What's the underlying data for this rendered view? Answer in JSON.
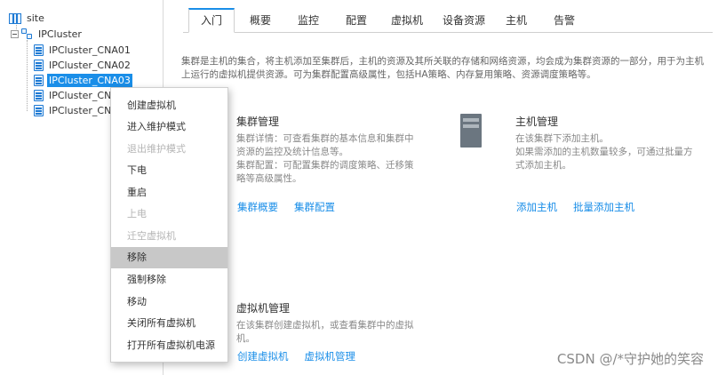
{
  "tree": {
    "root_label": "site",
    "cluster_label": "IPCluster",
    "hosts": [
      {
        "label": "IPCluster_CNA01",
        "selected": false
      },
      {
        "label": "IPCluster_CNA02",
        "selected": false
      },
      {
        "label": "IPCluster_CNA03",
        "selected": true
      },
      {
        "label": "IPCluster_CNA",
        "selected": false
      },
      {
        "label": "IPCluster_CNA",
        "selected": false
      }
    ]
  },
  "tabs": [
    {
      "label": "入门",
      "active": true
    },
    {
      "label": "概要",
      "active": false
    },
    {
      "label": "监控",
      "active": false
    },
    {
      "label": "配置",
      "active": false
    },
    {
      "label": "虚拟机",
      "active": false
    },
    {
      "label": "设备资源",
      "active": false
    },
    {
      "label": "主机",
      "active": false
    },
    {
      "label": "告警",
      "active": false
    }
  ],
  "intro": {
    "line1": "集群是主机的集合，将主机添加至集群后，主机的资源及其所关联的存储和网络资源，均会成为集群资源的一部分，用于为主机",
    "line2": "上运行的虚拟机提供资源。可为集群配置高级属性，包括HA策略、内存复用策略、资源调度策略等。"
  },
  "cluster_mgmt": {
    "title": "集群管理",
    "desc1": "集群详情：可查看集群的基本信息和集群中",
    "desc2": "资源的监控及统计信息等。",
    "desc3": "集群配置：可配置集群的调度策略、迁移策",
    "desc4": "略等高级属性。",
    "link1": "集群概要",
    "link2": "集群配置"
  },
  "host_mgmt": {
    "icon": "server-icon",
    "title": "主机管理",
    "desc1": "在该集群下添加主机。",
    "desc2": "如果需添加的主机数量较多，可通过批量方",
    "desc3": "式添加主机。",
    "link1": "添加主机",
    "link2": "批量添加主机"
  },
  "vm_mgmt": {
    "title": "虚拟机管理",
    "desc1": "在该集群创建虚拟机，或查看集群中的虚拟",
    "desc2": "机。",
    "link1": "创建虚拟机",
    "link2": "虚拟机管理"
  },
  "context_menu": {
    "items": [
      {
        "label": "创建虚拟机",
        "disabled": false,
        "hover": false
      },
      {
        "label": "进入维护模式",
        "disabled": false,
        "hover": false
      },
      {
        "label": "退出维护模式",
        "disabled": true,
        "hover": false
      },
      {
        "label": "下电",
        "disabled": false,
        "hover": false
      },
      {
        "label": "重启",
        "disabled": false,
        "hover": false
      },
      {
        "label": "上电",
        "disabled": true,
        "hover": false
      },
      {
        "label": "迁空虚拟机",
        "disabled": true,
        "hover": false
      },
      {
        "label": "移除",
        "disabled": false,
        "hover": true
      },
      {
        "label": "强制移除",
        "disabled": false,
        "hover": false
      },
      {
        "label": "移动",
        "disabled": false,
        "hover": false
      },
      {
        "label": "关闭所有虚拟机",
        "disabled": false,
        "hover": false
      },
      {
        "label": "打开所有虚拟机电源",
        "disabled": false,
        "hover": false
      }
    ]
  },
  "watermark": "CSDN @/*守护她的笑容",
  "colors": {
    "accent": "#1a8ee8",
    "selected_bg": "#1a8ee8",
    "hover_bg": "#c8c8c8"
  }
}
